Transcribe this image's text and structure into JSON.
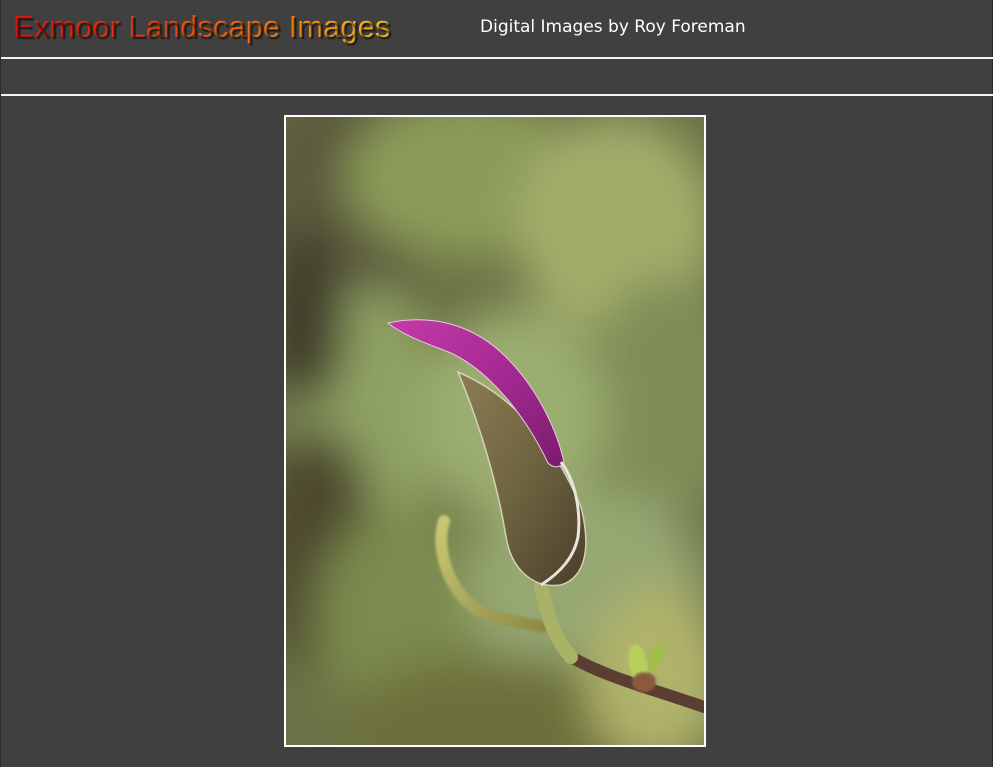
{
  "header": {
    "site_title": "Exmoor Landscape Images",
    "tagline": "Digital Images by Roy Foreman"
  },
  "colors": {
    "background": "#404040",
    "rule": "#f2f2f2",
    "title_gradient": [
      "#d8160f",
      "#f07a10",
      "#f6c21a"
    ],
    "tagline": "#ffffff"
  },
  "main": {
    "photo": {
      "subject": "magnolia-bud-photo"
    }
  }
}
